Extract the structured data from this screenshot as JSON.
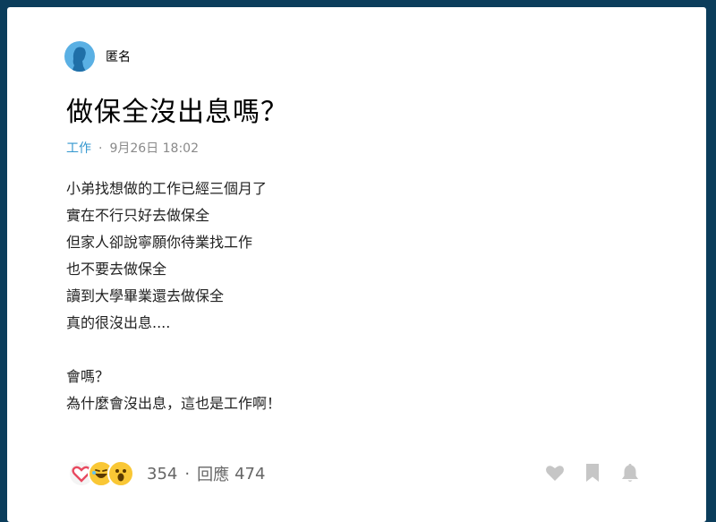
{
  "post": {
    "author": "匿名",
    "title": "做保全沒出息嗎？",
    "category": "工作",
    "timestamp": "9月26日 18:02",
    "lines": [
      "小弟找想做的工作已經三個月了",
      "實在不行只好去做保全",
      "但家人卻說寧願你待業找工作",
      "也不要去做保全",
      "讀到大學畢業還去做保全",
      "真的很沒出息....",
      "",
      "會嗎？",
      "為什麼會沒出息，這也是工作啊！"
    ]
  },
  "footer": {
    "reaction_count": "354",
    "reply_label": "回應",
    "reply_count": "474"
  },
  "colors": {
    "background": "#0b3d5b",
    "accent": "#3397cf",
    "avatar": "#5ab0e4"
  },
  "icons": [
    "heart-reaction-icon",
    "laugh-reaction-icon",
    "wow-reaction-icon",
    "like-icon",
    "bookmark-icon",
    "bell-icon"
  ]
}
